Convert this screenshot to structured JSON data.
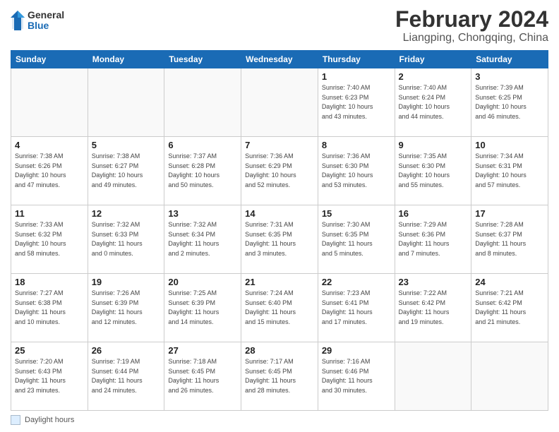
{
  "logo": {
    "general": "General",
    "blue": "Blue"
  },
  "title": "February 2024",
  "subtitle": "Liangping, Chongqing, China",
  "days_of_week": [
    "Sunday",
    "Monday",
    "Tuesday",
    "Wednesday",
    "Thursday",
    "Friday",
    "Saturday"
  ],
  "weeks": [
    [
      {
        "num": "",
        "info": ""
      },
      {
        "num": "",
        "info": ""
      },
      {
        "num": "",
        "info": ""
      },
      {
        "num": "",
        "info": ""
      },
      {
        "num": "1",
        "info": "Sunrise: 7:40 AM\nSunset: 6:23 PM\nDaylight: 10 hours\nand 43 minutes."
      },
      {
        "num": "2",
        "info": "Sunrise: 7:40 AM\nSunset: 6:24 PM\nDaylight: 10 hours\nand 44 minutes."
      },
      {
        "num": "3",
        "info": "Sunrise: 7:39 AM\nSunset: 6:25 PM\nDaylight: 10 hours\nand 46 minutes."
      }
    ],
    [
      {
        "num": "4",
        "info": "Sunrise: 7:38 AM\nSunset: 6:26 PM\nDaylight: 10 hours\nand 47 minutes."
      },
      {
        "num": "5",
        "info": "Sunrise: 7:38 AM\nSunset: 6:27 PM\nDaylight: 10 hours\nand 49 minutes."
      },
      {
        "num": "6",
        "info": "Sunrise: 7:37 AM\nSunset: 6:28 PM\nDaylight: 10 hours\nand 50 minutes."
      },
      {
        "num": "7",
        "info": "Sunrise: 7:36 AM\nSunset: 6:29 PM\nDaylight: 10 hours\nand 52 minutes."
      },
      {
        "num": "8",
        "info": "Sunrise: 7:36 AM\nSunset: 6:30 PM\nDaylight: 10 hours\nand 53 minutes."
      },
      {
        "num": "9",
        "info": "Sunrise: 7:35 AM\nSunset: 6:30 PM\nDaylight: 10 hours\nand 55 minutes."
      },
      {
        "num": "10",
        "info": "Sunrise: 7:34 AM\nSunset: 6:31 PM\nDaylight: 10 hours\nand 57 minutes."
      }
    ],
    [
      {
        "num": "11",
        "info": "Sunrise: 7:33 AM\nSunset: 6:32 PM\nDaylight: 10 hours\nand 58 minutes."
      },
      {
        "num": "12",
        "info": "Sunrise: 7:32 AM\nSunset: 6:33 PM\nDaylight: 11 hours\nand 0 minutes."
      },
      {
        "num": "13",
        "info": "Sunrise: 7:32 AM\nSunset: 6:34 PM\nDaylight: 11 hours\nand 2 minutes."
      },
      {
        "num": "14",
        "info": "Sunrise: 7:31 AM\nSunset: 6:35 PM\nDaylight: 11 hours\nand 3 minutes."
      },
      {
        "num": "15",
        "info": "Sunrise: 7:30 AM\nSunset: 6:35 PM\nDaylight: 11 hours\nand 5 minutes."
      },
      {
        "num": "16",
        "info": "Sunrise: 7:29 AM\nSunset: 6:36 PM\nDaylight: 11 hours\nand 7 minutes."
      },
      {
        "num": "17",
        "info": "Sunrise: 7:28 AM\nSunset: 6:37 PM\nDaylight: 11 hours\nand 8 minutes."
      }
    ],
    [
      {
        "num": "18",
        "info": "Sunrise: 7:27 AM\nSunset: 6:38 PM\nDaylight: 11 hours\nand 10 minutes."
      },
      {
        "num": "19",
        "info": "Sunrise: 7:26 AM\nSunset: 6:39 PM\nDaylight: 11 hours\nand 12 minutes."
      },
      {
        "num": "20",
        "info": "Sunrise: 7:25 AM\nSunset: 6:39 PM\nDaylight: 11 hours\nand 14 minutes."
      },
      {
        "num": "21",
        "info": "Sunrise: 7:24 AM\nSunset: 6:40 PM\nDaylight: 11 hours\nand 15 minutes."
      },
      {
        "num": "22",
        "info": "Sunrise: 7:23 AM\nSunset: 6:41 PM\nDaylight: 11 hours\nand 17 minutes."
      },
      {
        "num": "23",
        "info": "Sunrise: 7:22 AM\nSunset: 6:42 PM\nDaylight: 11 hours\nand 19 minutes."
      },
      {
        "num": "24",
        "info": "Sunrise: 7:21 AM\nSunset: 6:42 PM\nDaylight: 11 hours\nand 21 minutes."
      }
    ],
    [
      {
        "num": "25",
        "info": "Sunrise: 7:20 AM\nSunset: 6:43 PM\nDaylight: 11 hours\nand 23 minutes."
      },
      {
        "num": "26",
        "info": "Sunrise: 7:19 AM\nSunset: 6:44 PM\nDaylight: 11 hours\nand 24 minutes."
      },
      {
        "num": "27",
        "info": "Sunrise: 7:18 AM\nSunset: 6:45 PM\nDaylight: 11 hours\nand 26 minutes."
      },
      {
        "num": "28",
        "info": "Sunrise: 7:17 AM\nSunset: 6:45 PM\nDaylight: 11 hours\nand 28 minutes."
      },
      {
        "num": "29",
        "info": "Sunrise: 7:16 AM\nSunset: 6:46 PM\nDaylight: 11 hours\nand 30 minutes."
      },
      {
        "num": "",
        "info": ""
      },
      {
        "num": "",
        "info": ""
      }
    ]
  ],
  "footer_legend": "Daylight hours"
}
